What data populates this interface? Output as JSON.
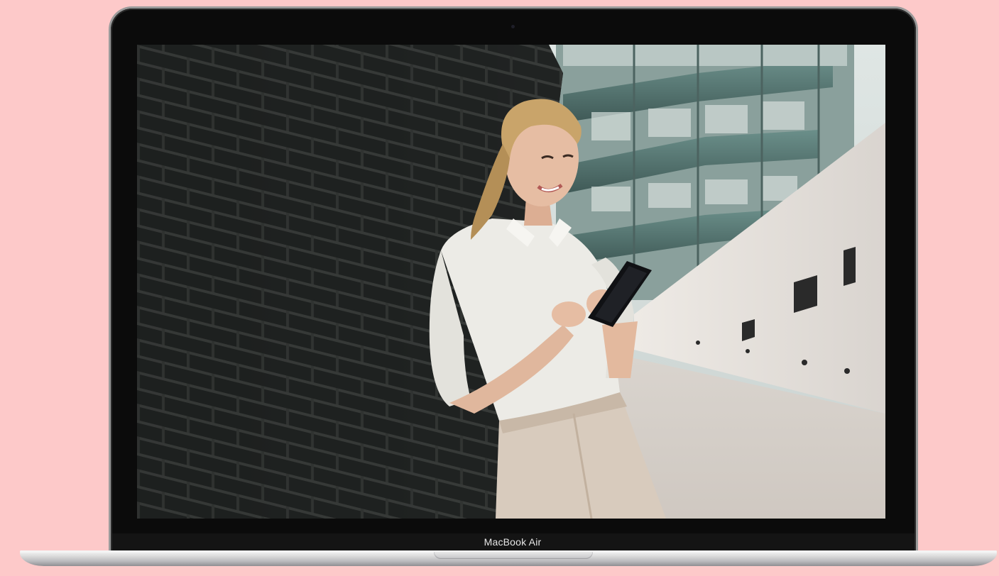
{
  "device": {
    "model_label": "MacBook Air"
  },
  "photo": {
    "subject": "woman-with-smartphone-icon"
  },
  "colors": {
    "background": "#fdc9c9",
    "bezel": "#0b0b0b",
    "shirt": "#ecebe6",
    "trousers": "#d8cbbd",
    "hair": "#c9a46a",
    "brick": "#1c1e1d"
  }
}
